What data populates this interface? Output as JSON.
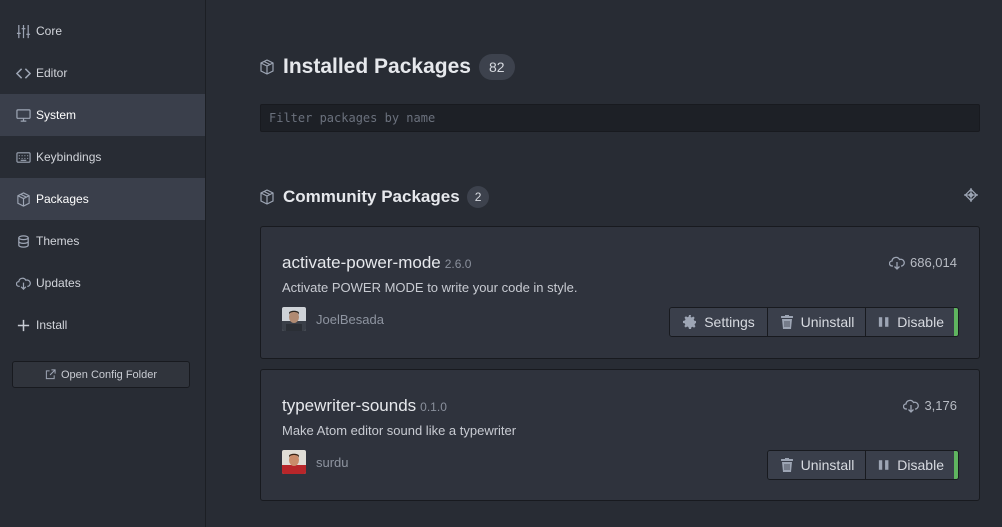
{
  "sidebar": {
    "items": [
      {
        "label": "Core",
        "icon": "sliders-icon"
      },
      {
        "label": "Editor",
        "icon": "code-icon"
      },
      {
        "label": "System",
        "icon": "monitor-icon"
      },
      {
        "label": "Keybindings",
        "icon": "keyboard-icon"
      },
      {
        "label": "Packages",
        "icon": "package-icon"
      },
      {
        "label": "Themes",
        "icon": "paintcan-icon"
      },
      {
        "label": "Updates",
        "icon": "cloud-download-icon"
      },
      {
        "label": "Install",
        "icon": "plus-icon"
      }
    ],
    "open_config_label": "Open Config Folder"
  },
  "installed": {
    "title": "Installed Packages",
    "count": "82",
    "filter_placeholder": "Filter packages by name"
  },
  "community": {
    "title": "Community Packages",
    "count": "2",
    "packages": [
      {
        "name": "activate-power-mode",
        "version": "2.6.0",
        "description": "Activate POWER MODE to write your code in style.",
        "author": "JoelBesada",
        "downloads": "686,014",
        "buttons": {
          "settings": "Settings",
          "uninstall": "Uninstall",
          "disable": "Disable"
        }
      },
      {
        "name": "typewriter-sounds",
        "version": "0.1.0",
        "description": "Make Atom editor sound like a typewriter",
        "author": "surdu",
        "downloads": "3,176",
        "buttons": {
          "uninstall": "Uninstall",
          "disable": "Disable"
        }
      }
    ]
  },
  "colors": {
    "background": "#282c34",
    "card": "#2f333d",
    "active_item": "#3a3f4b",
    "enabled_indicator": "#5fb45f"
  }
}
